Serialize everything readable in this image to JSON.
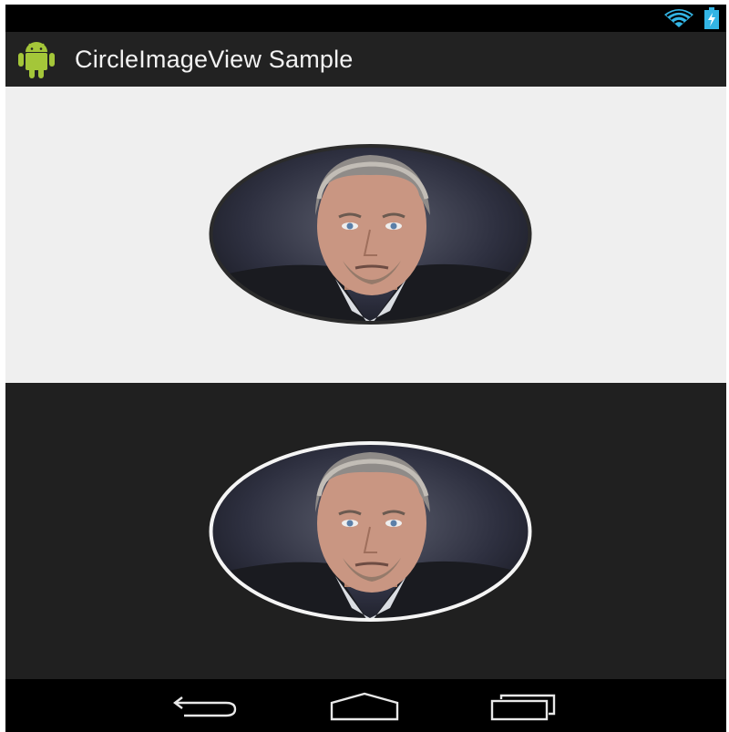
{
  "app": {
    "title": "CircleImageView Sample"
  },
  "status_bar": {
    "icons": [
      "wifi-icon",
      "battery-charging-icon"
    ],
    "accent_color": "#33b5e5"
  },
  "panels": [
    {
      "name": "light-panel",
      "background": "#efefef",
      "border_color": "#2b2b2b"
    },
    {
      "name": "dark-panel",
      "background": "#202020",
      "border_color": "#f5f5f5"
    }
  ],
  "navigation": {
    "buttons": [
      "back-icon",
      "home-icon",
      "recents-icon"
    ]
  }
}
